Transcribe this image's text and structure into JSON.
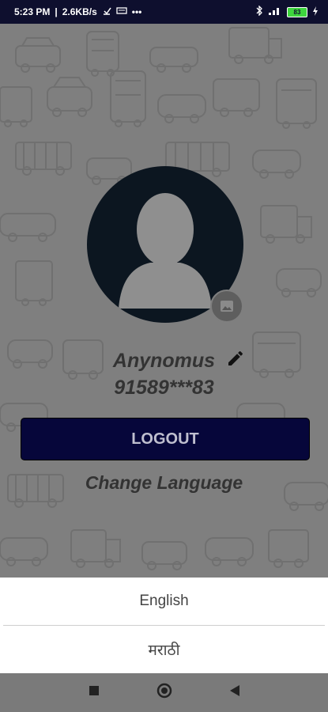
{
  "status_bar": {
    "time": "5:23 PM",
    "network_speed": "2.6KB/s",
    "battery_level": "83",
    "icons": [
      "bluetooth-icon",
      "signal-icon",
      "wifi-icon",
      "battery-icon",
      "charging-icon"
    ]
  },
  "profile": {
    "name": "Anynomus",
    "phone": "91589***83"
  },
  "actions": {
    "logout_label": "LOGOUT",
    "change_language_label": "Change Language"
  },
  "language_sheet": {
    "options": [
      {
        "label": "English"
      },
      {
        "label": "मराठी"
      }
    ]
  },
  "colors": {
    "status_bar": "#0e0f2e",
    "avatar": "#0c1620",
    "logout_button": "#06063a",
    "overlay": "#7f7f7f"
  }
}
